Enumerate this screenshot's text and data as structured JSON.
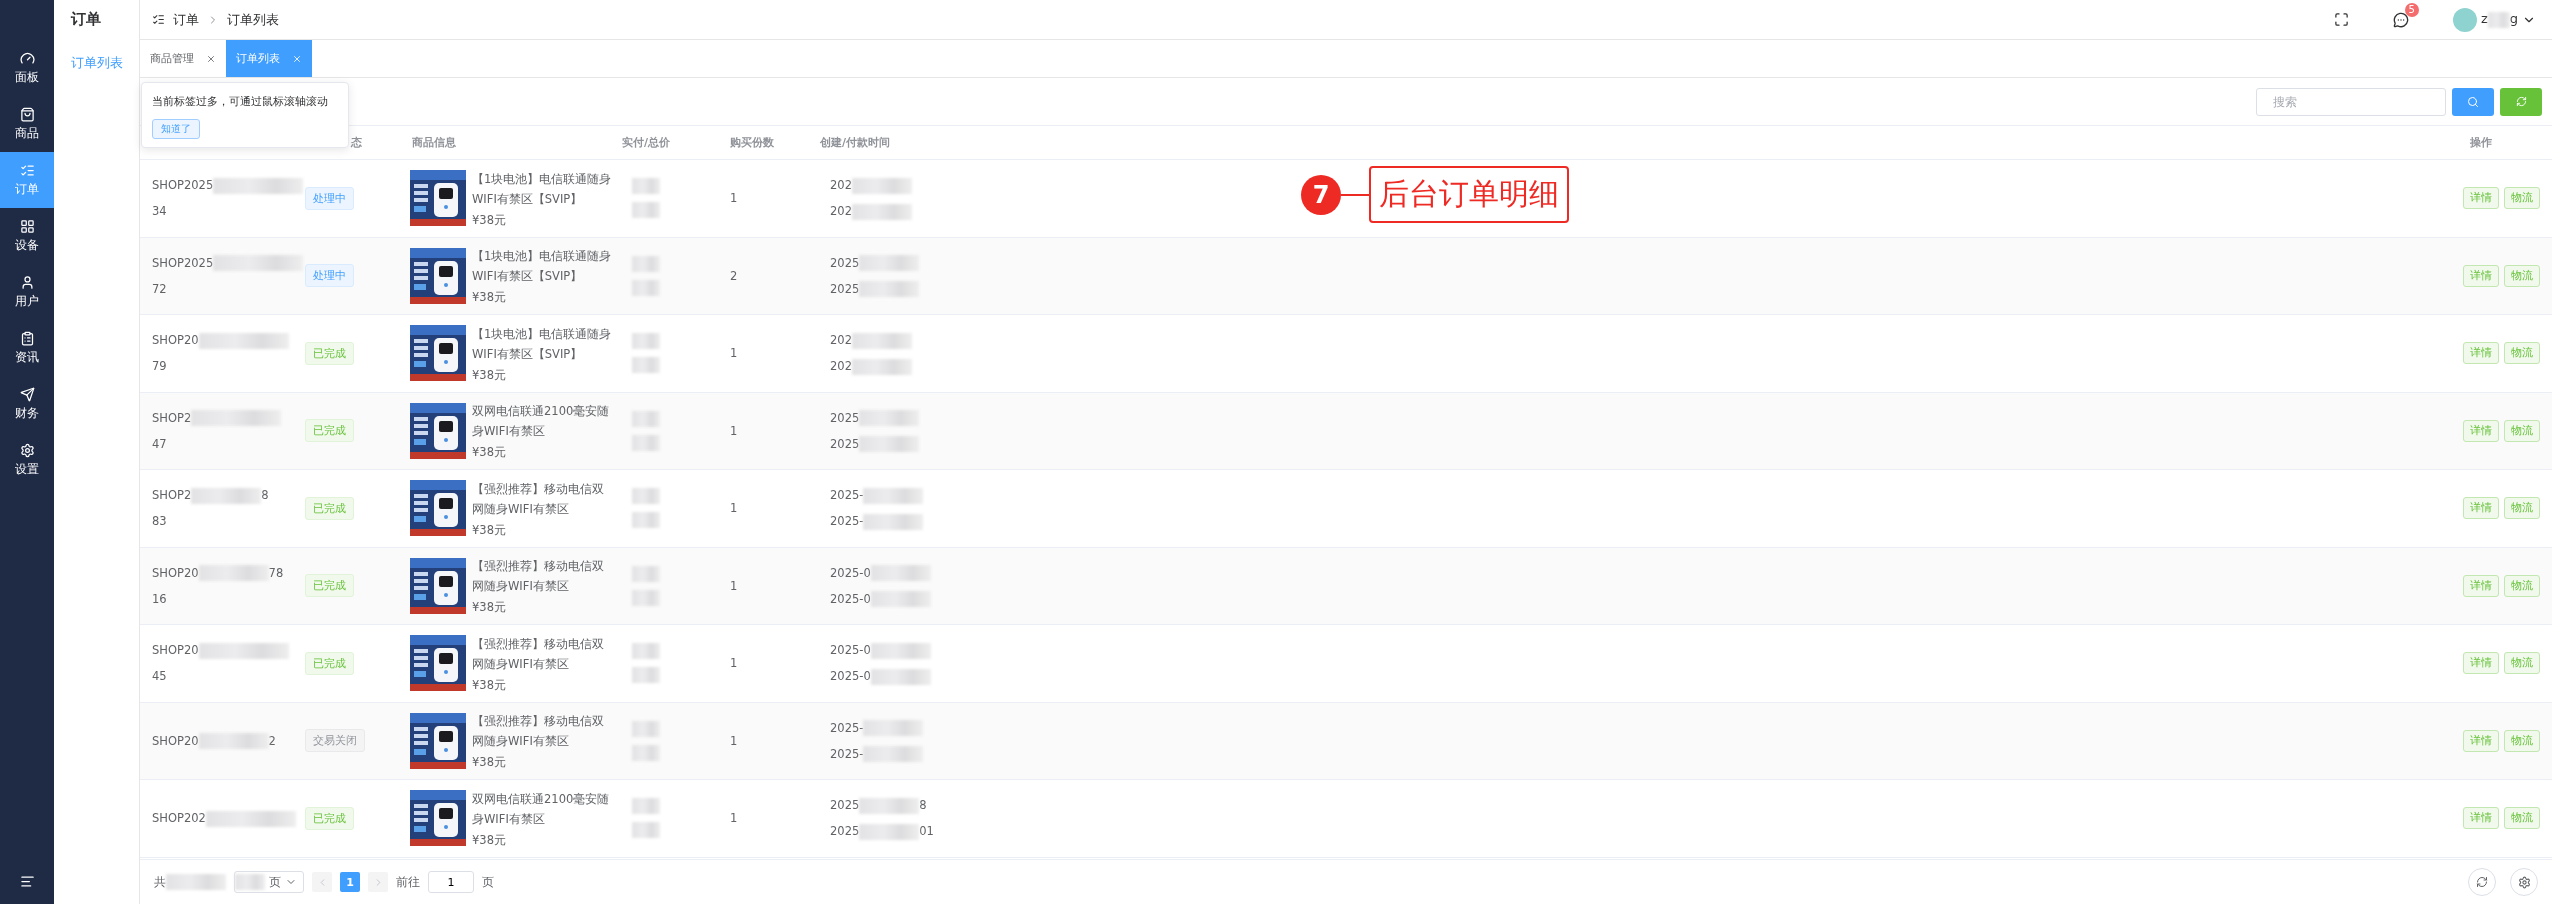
{
  "sidebar": {
    "items": [
      {
        "label": "面板",
        "selected": false
      },
      {
        "label": "商品",
        "selected": false
      },
      {
        "label": "订单",
        "selected": true
      },
      {
        "label": "设备",
        "selected": false
      },
      {
        "label": "用户",
        "selected": false
      },
      {
        "label": "资讯",
        "selected": false
      },
      {
        "label": "财务",
        "selected": false
      },
      {
        "label": "设置",
        "selected": false
      }
    ]
  },
  "submenu": {
    "title": "订单",
    "items": [
      {
        "label": "订单列表",
        "selected": true
      }
    ]
  },
  "breadcrumb": [
    "订单",
    "订单列表"
  ],
  "header": {
    "message_count": "5",
    "username_start": "z",
    "username_end": "g"
  },
  "tabs": [
    {
      "label": "商品管理",
      "selected": false
    },
    {
      "label": "订单列表",
      "selected": true
    }
  ],
  "tip": {
    "text": "当前标签过多，可通过鼠标滚轴滚动",
    "button": "知道了"
  },
  "search": {
    "placeholder": "搜索"
  },
  "table": {
    "columns": [
      "态",
      "商品信息",
      "实付/总价",
      "购买份数",
      "创建/付款时间",
      "操作"
    ],
    "rows": [
      {
        "id": [
          {
            "start": "SHOP2025",
            "blurred": true
          },
          {
            "start": "34",
            "blurred": false
          }
        ],
        "status": {
          "kind": "processing",
          "label": "处理中"
        },
        "product": {
          "title": "【1块电池】电信联通随身WIFI有禁区【SVIP】",
          "price": "¥38元"
        },
        "qty": "1",
        "times": [
          {
            "start": "202",
            "blurred": true
          },
          {
            "start": "202",
            "blurred": true
          }
        ],
        "actions": [
          "详情",
          "物流"
        ]
      },
      {
        "id": [
          {
            "start": "SHOP2025",
            "blurred": true
          },
          {
            "start": "72",
            "blurred": false
          }
        ],
        "status": {
          "kind": "processing",
          "label": "处理中"
        },
        "product": {
          "title": "【1块电池】电信联通随身WIFI有禁区【SVIP】",
          "price": "¥38元"
        },
        "qty": "2",
        "times": [
          {
            "start": "2025",
            "blurred": true
          },
          {
            "start": "2025",
            "blurred": true
          }
        ],
        "actions": [
          "详情",
          "物流"
        ]
      },
      {
        "id": [
          {
            "start": "SHOP20",
            "blurred": true
          },
          {
            "start": "79",
            "blurred": false
          }
        ],
        "status": {
          "kind": "done",
          "label": "已完成"
        },
        "product": {
          "title": "【1块电池】电信联通随身WIFI有禁区【SVIP】",
          "price": "¥38元"
        },
        "qty": "1",
        "times": [
          {
            "start": "202",
            "blurred": true
          },
          {
            "start": "202",
            "blurred": true
          }
        ],
        "actions": [
          "详情",
          "物流"
        ]
      },
      {
        "id": [
          {
            "start": "SHOP2",
            "blurred": true
          },
          {
            "start": "47",
            "blurred": false
          }
        ],
        "status": {
          "kind": "done",
          "label": "已完成"
        },
        "product": {
          "title": "双网电信联通2100毫安随身WIFI有禁区",
          "price": "¥38元"
        },
        "qty": "1",
        "times": [
          {
            "start": "2025",
            "blurred": true
          },
          {
            "start": "2025",
            "blurred": true
          }
        ],
        "actions": [
          "详情",
          "物流"
        ]
      },
      {
        "id": [
          {
            "start": "SHOP2",
            "blurred": true,
            "end": "8"
          },
          {
            "start": "83",
            "blurred": false
          }
        ],
        "status": {
          "kind": "done",
          "label": "已完成"
        },
        "product": {
          "title": "【强烈推荐】移动电信双网随身WIFI有禁区",
          "price": "¥38元"
        },
        "qty": "1",
        "times": [
          {
            "start": "2025-",
            "blurred": true
          },
          {
            "start": "2025-",
            "blurred": true
          }
        ],
        "actions": [
          "详情",
          "物流"
        ]
      },
      {
        "id": [
          {
            "start": "SHOP20",
            "blurred": true,
            "end": "78"
          },
          {
            "start": "16",
            "blurred": false
          }
        ],
        "status": {
          "kind": "done",
          "label": "已完成"
        },
        "product": {
          "title": "【强烈推荐】移动电信双网随身WIFI有禁区",
          "price": "¥38元"
        },
        "qty": "1",
        "times": [
          {
            "start": "2025-0",
            "blurred": true
          },
          {
            "start": "2025-0",
            "blurred": true
          }
        ],
        "actions": [
          "详情",
          "物流"
        ]
      },
      {
        "id": [
          {
            "start": "SHOP20",
            "blurred": true
          },
          {
            "start": "45",
            "blurred": false
          }
        ],
        "status": {
          "kind": "done",
          "label": "已完成"
        },
        "product": {
          "title": "【强烈推荐】移动电信双网随身WIFI有禁区",
          "price": "¥38元"
        },
        "qty": "1",
        "times": [
          {
            "start": "2025-0",
            "blurred": true
          },
          {
            "start": "2025-0",
            "blurred": true
          }
        ],
        "actions": [
          "详情",
          "物流"
        ]
      },
      {
        "id": [
          {
            "start": "SHOP20",
            "blurred": true,
            "end": "2"
          }
        ],
        "status": {
          "kind": "closed",
          "label": "交易关闭"
        },
        "product": {
          "title": "【强烈推荐】移动电信双网随身WIFI有禁区",
          "price": "¥38元"
        },
        "qty": "1",
        "times": [
          {
            "start": "2025-",
            "blurred": true
          },
          {
            "start": "2025-",
            "blurred": true
          }
        ],
        "actions": [
          "详情",
          "物流"
        ]
      },
      {
        "id": [
          {
            "start": "SHOP202",
            "blurred": true
          }
        ],
        "status": {
          "kind": "done",
          "label": "已完成"
        },
        "product": {
          "title": "双网电信联通2100毫安随身WIFI有禁区",
          "price": "¥38元"
        },
        "qty": "1",
        "times": [
          {
            "start": "2025",
            "blurred": true,
            "end": "8"
          },
          {
            "start": "2025",
            "blurred": true,
            "end": "01"
          }
        ],
        "actions": [
          "详情",
          "物流"
        ]
      }
    ]
  },
  "annotation": {
    "number": "7",
    "text": "后台订单明细"
  },
  "pagination": {
    "total_prefix": "共",
    "size_suffix": "页",
    "pages": [
      {
        "label": "1",
        "selected": true
      }
    ],
    "goto_label": "前往",
    "goto_value": "1",
    "goto_suffix": "页"
  }
}
